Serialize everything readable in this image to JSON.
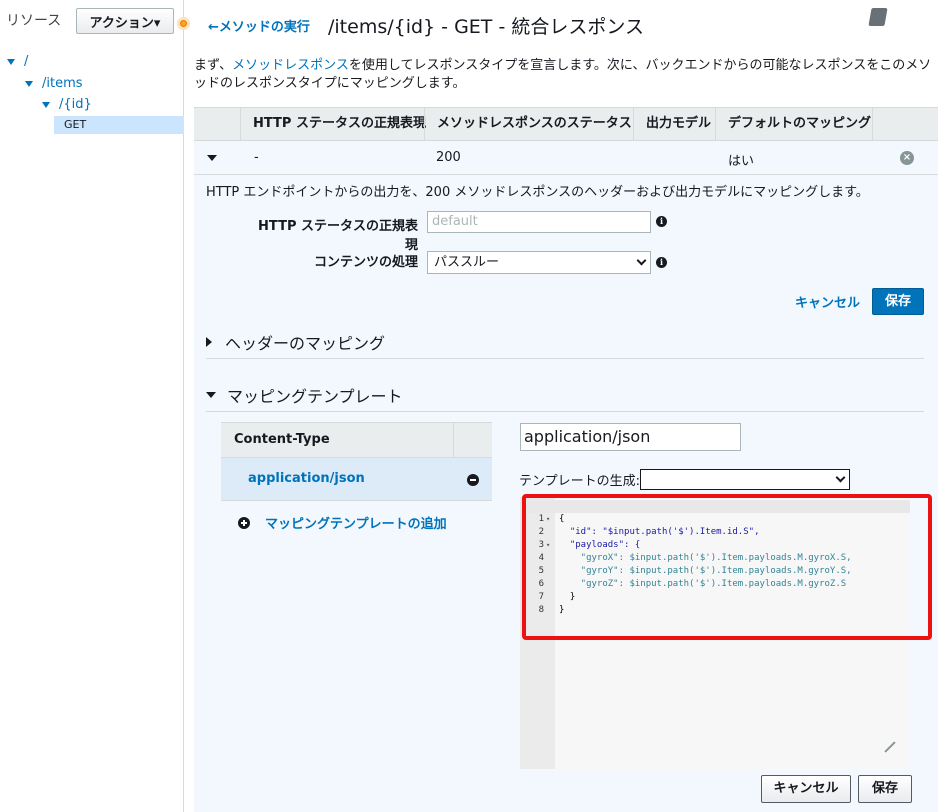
{
  "sidebar": {
    "title": "リソース",
    "action_button": "アクション▾",
    "tree": [
      {
        "label": "/"
      },
      {
        "label": "/items"
      },
      {
        "label": "/{id}"
      },
      {
        "label": "GET"
      }
    ]
  },
  "header": {
    "back_link": "メソッドの実行",
    "title": "/items/{id} - GET - 統合レスポンス"
  },
  "description": {
    "prefix": "まず、",
    "link": "メソッドレスポンス",
    "suffix": "を使用してレスポンスタイプを宣言します。次に、バックエンドからの可能なレスポンスをこのメソッドのレスポンスタイプにマッピングします。"
  },
  "table": {
    "headers": [
      "HTTP ステータスの正規表現",
      "メソッドレスポンスのステータス",
      "出力モデル",
      "デフォルトのマッピング"
    ],
    "row": {
      "regex": "-",
      "status": "200",
      "model": "",
      "default": "はい"
    }
  },
  "detail": {
    "text": "HTTP エンドポイントからの出力を、200 メソッドレスポンスのヘッダーおよび出力モデルにマッピングします。",
    "regex_label": "HTTP ステータスの正規表現",
    "regex_placeholder": "default",
    "content_label": "コンテンツの処理",
    "content_value": "パススルー",
    "cancel": "キャンセル",
    "save": "保存"
  },
  "sections": {
    "header_mapping": "ヘッダーのマッピング",
    "template_mapping": "マッピングテンプレート"
  },
  "content_types": {
    "header": "Content-Type",
    "items": [
      "application/json"
    ],
    "add_label": "マッピングテンプレートの追加"
  },
  "template": {
    "content_type_value": "application/json",
    "generate_label": "テンプレートの生成:",
    "generate_value": "",
    "code_lines": [
      "{",
      "  \"id\": \"$input.path('$').Item.id.S\",",
      "  \"payloads\": {",
      "    \"gyroX\": $input.path('$').Item.payloads.M.gyroX.S,",
      "    \"gyroY\": $input.path('$').Item.payloads.M.gyroY.S,",
      "    \"gyroZ\": $input.path('$').Item.payloads.M.gyroZ.S",
      "  }",
      "}"
    ],
    "cancel": "キャンセル",
    "save": "保存"
  },
  "colors": {
    "link": "#0073bb",
    "primary_button": "#0073bb",
    "selected_bg": "#dcebf7",
    "highlight_frame": "#e11111"
  }
}
